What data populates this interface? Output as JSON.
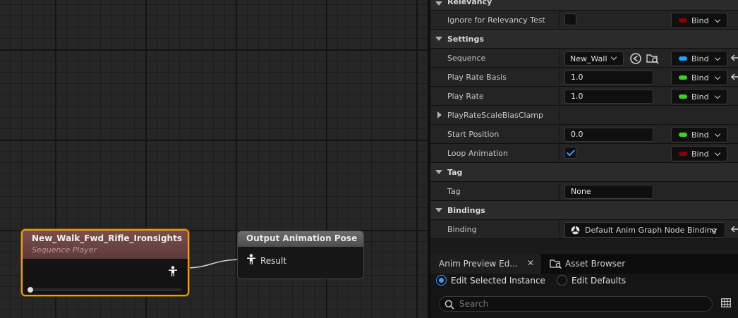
{
  "graph": {
    "sequence_node": {
      "title": "New_Walk_Fwd_Rifle_Ironsights",
      "subtitle": "Sequence Player",
      "progress": 0.0
    },
    "output_node": {
      "title": "Output Animation Pose",
      "pin_label": "Result"
    }
  },
  "details": {
    "relevancy": {
      "header": "Relevancy",
      "ignore_label": "Ignore for Relevancy Test",
      "ignore_checked": false,
      "ignore_bind": "Bind"
    },
    "settings": {
      "header": "Settings",
      "sequence_label": "Sequence",
      "sequence_value": "New_Wall",
      "sequence_bind": "Bind",
      "play_rate_basis_label": "Play Rate Basis",
      "play_rate_basis_value": "1.0",
      "play_rate_basis_bind": "Bind",
      "play_rate_label": "Play Rate",
      "play_rate_value": "1.0",
      "play_rate_bind": "Bind",
      "bias_clamp_label": "PlayRateScaleBiasClamp",
      "start_position_label": "Start Position",
      "start_position_value": "0.0",
      "start_position_bind": "Bind",
      "loop_label": "Loop Animation",
      "loop_checked": true,
      "loop_bind": "Bind"
    },
    "tag": {
      "header": "Tag",
      "tag_label": "Tag",
      "tag_value": "None"
    },
    "bindings": {
      "header": "Bindings",
      "binding_label": "Binding",
      "binding_value": "Default Anim Graph Node Binding"
    }
  },
  "bottom": {
    "tabs": {
      "anim_preview": "Anim Preview Ed...",
      "asset_browser": "Asset Browser"
    },
    "modes": {
      "selected": "Edit Selected Instance",
      "defaults": "Edit Defaults"
    },
    "search_placeholder": "Search"
  },
  "colors": {
    "selection": "#f0a000",
    "pin_bool": "#8b0000",
    "pin_object": "#1aa3ff",
    "pin_float": "#3ccf2a",
    "accent": "#3d9bff"
  }
}
